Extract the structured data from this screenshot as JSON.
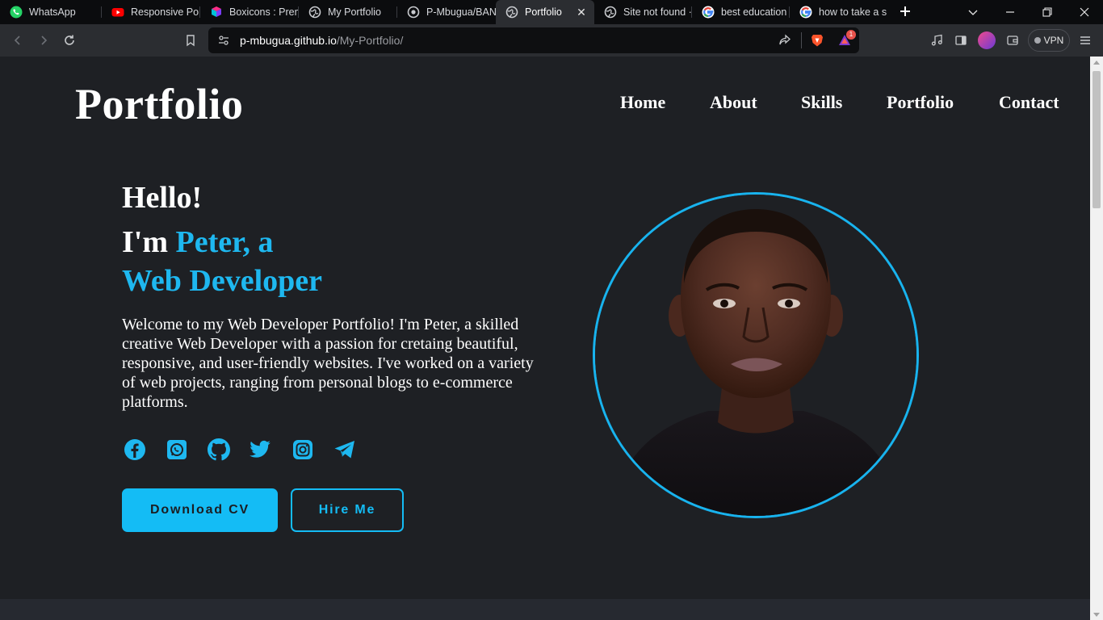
{
  "browser": {
    "tabs": [
      {
        "label": "WhatsApp",
        "icon": "whatsapp-icon"
      },
      {
        "label": "Responsive Port",
        "icon": "youtube-icon"
      },
      {
        "label": "Boxicons : Prem",
        "icon": "boxicons-icon"
      },
      {
        "label": "My Portfolio",
        "icon": "globe-icon"
      },
      {
        "label": "P-Mbugua/BAN",
        "icon": "github-icon"
      },
      {
        "label": "Portfolio",
        "icon": "globe-icon",
        "active": true
      },
      {
        "label": "Site not found ·",
        "icon": "globe-icon"
      },
      {
        "label": "best education i",
        "icon": "google-icon"
      },
      {
        "label": "how to take a sc",
        "icon": "google-icon"
      }
    ],
    "url_host": "p-mbugua.github.io",
    "url_path": "/My-Portfolio/",
    "vpn_label": "VPN",
    "rewards_badge": "1"
  },
  "site": {
    "logo": "Portfolio",
    "nav": [
      "Home",
      "About",
      "Skills",
      "Portfolio",
      "Contact"
    ]
  },
  "hero": {
    "greeting": "Hello!",
    "im": "I'm",
    "name": "Peter, a",
    "role": "Web Developer",
    "intro": "Welcome to my Web Developer Portfolio! I'm Peter, a skilled creative Web Developer with a passion for cretaing beautiful, responsive, and user-friendly websites. I've worked on a variety of web projects, ranging from personal blogs to e-commerce platforms.",
    "social_icons": [
      "facebook-icon",
      "whatsapp-icon",
      "github-icon",
      "twitter-icon",
      "instagram-icon",
      "telegram-icon"
    ],
    "download_cv": "Download CV",
    "hire_me": "Hire Me"
  },
  "colors": {
    "accent": "#1eb8f0",
    "background": "#1e2024",
    "text": "#ffffff"
  }
}
